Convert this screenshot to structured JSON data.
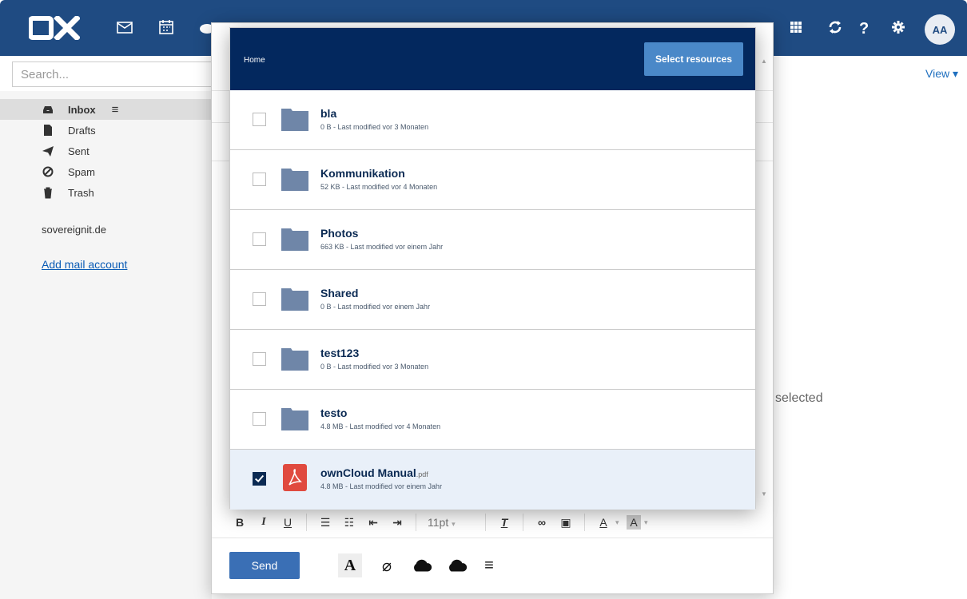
{
  "app": {
    "logo_text": "OX",
    "avatar_initials": "AA",
    "search_placeholder": "Search...",
    "view_label": "View ▾",
    "no_selection_text": "selected"
  },
  "sidebar": {
    "folders": [
      {
        "label": "Inbox",
        "icon": "inbox-icon",
        "selected": true
      },
      {
        "label": "Drafts",
        "icon": "file-icon",
        "selected": false
      },
      {
        "label": "Sent",
        "icon": "paper-plane-icon",
        "selected": false
      },
      {
        "label": "Spam",
        "icon": "ban-icon",
        "selected": false
      },
      {
        "label": "Trash",
        "icon": "trash-icon",
        "selected": false
      }
    ],
    "account_name": "sovereignit.de",
    "add_account_label": "Add mail account"
  },
  "compose": {
    "font_size": "11pt",
    "send_label": "Send"
  },
  "picker": {
    "breadcrumb": "Home",
    "select_button_label": "Select resources",
    "items": [
      {
        "name": "bla",
        "ext": "",
        "meta": "0 B - Last modified vor 3 Monaten",
        "type": "folder",
        "checked": false
      },
      {
        "name": "Kommunikation",
        "ext": "",
        "meta": "52 KB - Last modified vor 4 Monaten",
        "type": "folder",
        "checked": false
      },
      {
        "name": "Photos",
        "ext": "",
        "meta": "663 KB - Last modified vor einem Jahr",
        "type": "folder",
        "checked": false
      },
      {
        "name": "Shared",
        "ext": "",
        "meta": "0 B - Last modified vor einem Jahr",
        "type": "folder",
        "checked": false
      },
      {
        "name": "test123",
        "ext": "",
        "meta": "0 B - Last modified vor 3 Monaten",
        "type": "folder",
        "checked": false
      },
      {
        "name": "testo",
        "ext": "",
        "meta": "4.8 MB - Last modified vor 4 Monaten",
        "type": "folder",
        "checked": false
      },
      {
        "name": "ownCloud Manual",
        "ext": ".pdf",
        "meta": "4.8 MB - Last modified vor einem Jahr",
        "type": "pdf",
        "checked": true
      }
    ]
  },
  "colors": {
    "topbar": "#1f4b82",
    "picker_header": "#03285e",
    "accent": "#4a88c8",
    "folder_icon": "#6f86a8",
    "pdf_icon": "#e04a3f"
  }
}
